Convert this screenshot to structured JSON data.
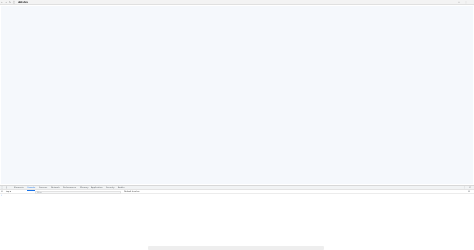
{
  "browser": {
    "icons": {
      "back": "back-arrow-icon",
      "forward": "forward-arrow-icon",
      "reload": "reload-icon",
      "info": "site-info-icon",
      "star": "bookmark-star-icon",
      "menu": "menu-icon"
    },
    "url_text": "ubk.dev"
  },
  "devtools": {
    "tabs": [
      {
        "label": "Elements"
      },
      {
        "label": "Console"
      },
      {
        "label": "Sources"
      },
      {
        "label": "Network"
      },
      {
        "label": "Performance"
      },
      {
        "label": "Memory"
      },
      {
        "label": "Application"
      },
      {
        "label": "Security"
      },
      {
        "label": "Audits"
      }
    ],
    "active_tab": "Console",
    "context": "top",
    "filter_placeholder": "Filter",
    "levels_label": "Default levels",
    "prompt": "›"
  },
  "colors": {
    "viewport_bg": "#f5f8fc",
    "accent": "#1a73e8"
  }
}
